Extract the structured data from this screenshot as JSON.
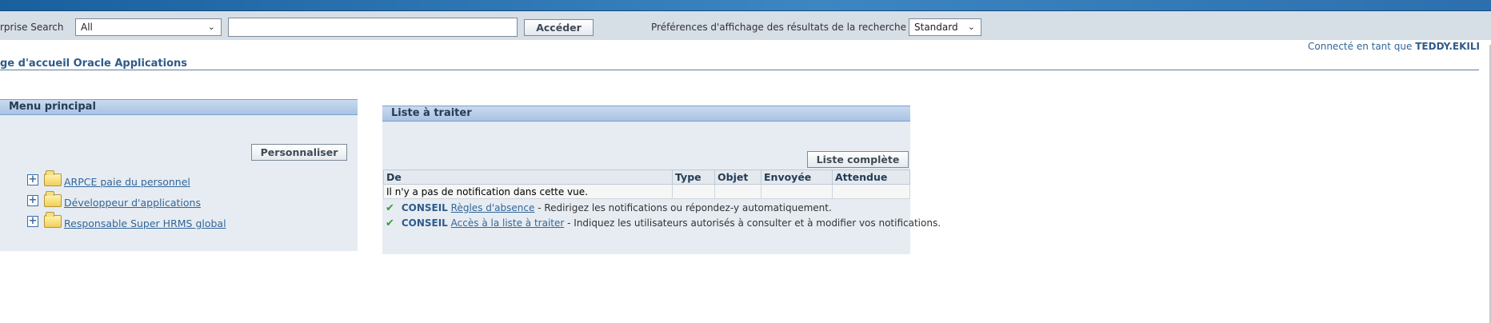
{
  "header": {
    "search_label": "rprise Search",
    "search_scope": "All",
    "search_value": "",
    "go_button": "Accéder",
    "pref_label": "Préférences d'affichage des résultats de la recherche",
    "pref_value": "Standard",
    "connected_prefix": "Connecté en tant que",
    "user": "TEDDY.EKILI"
  },
  "page": {
    "title": "ge d'accueil Oracle Applications"
  },
  "main_menu": {
    "title": "Menu principal",
    "personalize_button": "Personnaliser",
    "items": [
      {
        "label": "ARPCE paie du personnel"
      },
      {
        "label": "Développeur d'applications"
      },
      {
        "label": "Responsable Super HRMS global"
      }
    ]
  },
  "worklist": {
    "title": "Liste à traiter",
    "full_list_button": "Liste complète",
    "columns": [
      "De",
      "Type",
      "Objet",
      "Envoyée",
      "Attendue"
    ],
    "empty_message": "Il n'y a pas de notification dans cette vue.",
    "tips": [
      {
        "keyword": "CONSEIL",
        "link": "Règles d'absence",
        "text": " - Redirigez les notifications ou répondez-y automatiquement."
      },
      {
        "keyword": "CONSEIL",
        "link": "Accès à la liste à traiter",
        "text": " - Indiquez les utilisateurs autorisés à consulter et à modifier vos notifications."
      }
    ]
  }
}
